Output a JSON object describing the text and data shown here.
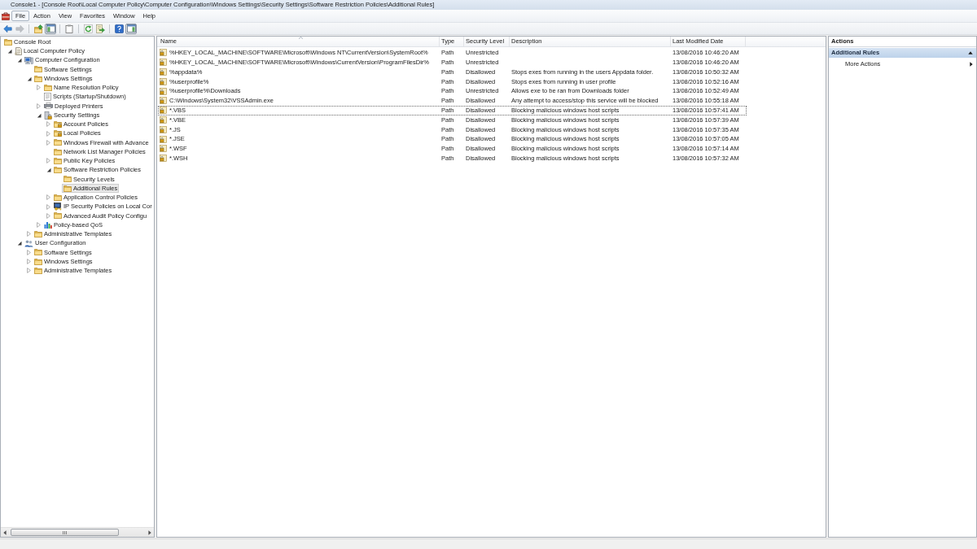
{
  "window": {
    "title": "Console1 - [Console Root\\Local Computer Policy\\Computer Configuration\\Windows Settings\\Security Settings\\Software Restriction Policies\\Additional Rules]"
  },
  "menu": [
    {
      "label": "File",
      "highlighted": true
    },
    {
      "label": "Action",
      "highlighted": false
    },
    {
      "label": "View",
      "highlighted": false
    },
    {
      "label": "Favorites",
      "highlighted": false
    },
    {
      "label": "Window",
      "highlighted": false
    },
    {
      "label": "Help",
      "highlighted": false
    }
  ],
  "toolbar": [
    {
      "kind": "back",
      "disabled": false,
      "pressed": false
    },
    {
      "kind": "forward",
      "disabled": true,
      "pressed": false
    },
    {
      "kind": "separator"
    },
    {
      "kind": "up",
      "disabled": false,
      "pressed": false
    },
    {
      "kind": "console-tree",
      "disabled": false,
      "pressed": true
    },
    {
      "kind": "separator"
    },
    {
      "kind": "properties",
      "disabled": false,
      "pressed": false
    },
    {
      "kind": "separator"
    },
    {
      "kind": "refresh",
      "disabled": false,
      "pressed": false
    },
    {
      "kind": "export",
      "disabled": false,
      "pressed": false
    },
    {
      "kind": "separator"
    },
    {
      "kind": "help",
      "disabled": false,
      "pressed": false
    },
    {
      "kind": "action-pane",
      "disabled": false,
      "pressed": true
    }
  ],
  "tree": [
    {
      "label": "Console Root",
      "kind": "folder",
      "selected": false,
      "children": [
        {
          "label": "Local Computer Policy",
          "kind": "policy",
          "selected": false,
          "expanded": true,
          "children": [
            {
              "label": "Computer Configuration",
              "kind": "computer",
              "selected": false,
              "expanded": true,
              "children": [
                {
                  "label": "Software Settings",
                  "kind": "folder",
                  "selected": false
                },
                {
                  "label": "Windows Settings",
                  "kind": "folder",
                  "selected": false,
                  "expanded": true,
                  "children": [
                    {
                      "label": "Name Resolution Policy",
                      "kind": "folder",
                      "selected": false,
                      "expanded": false
                    },
                    {
                      "label": "Scripts (Startup/Shutdown)",
                      "kind": "script",
                      "selected": false
                    },
                    {
                      "label": "Deployed Printers",
                      "kind": "printer",
                      "selected": false,
                      "expanded": false
                    },
                    {
                      "label": "Security Settings",
                      "kind": "security",
                      "selected": false,
                      "expanded": true,
                      "children": [
                        {
                          "label": "Account Policies",
                          "kind": "lock-folder",
                          "selected": false,
                          "expanded": false
                        },
                        {
                          "label": "Local Policies",
                          "kind": "lock-folder",
                          "selected": false,
                          "expanded": false
                        },
                        {
                          "label": "Windows Firewall with Advance",
                          "kind": "folder",
                          "selected": false,
                          "expanded": false
                        },
                        {
                          "label": "Network List Manager Policies",
                          "kind": "folder",
                          "selected": false
                        },
                        {
                          "label": "Public Key Policies",
                          "kind": "folder",
                          "selected": false,
                          "expanded": false
                        },
                        {
                          "label": "Software Restriction Policies",
                          "kind": "folder",
                          "selected": false,
                          "expanded": true,
                          "children": [
                            {
                              "label": "Security Levels",
                              "kind": "folder",
                              "selected": false
                            },
                            {
                              "label": "Additional Rules",
                              "kind": "folder",
                              "selected": true
                            }
                          ]
                        },
                        {
                          "label": "Application Control Policies",
                          "kind": "folder",
                          "selected": false,
                          "expanded": false
                        },
                        {
                          "label": "IP Security Policies on Local Cor",
                          "kind": "ip-security",
                          "selected": false,
                          "expanded": false
                        },
                        {
                          "label": "Advanced Audit Policy Configu",
                          "kind": "folder",
                          "selected": false,
                          "expanded": false
                        }
                      ]
                    },
                    {
                      "label": "Policy-based QoS",
                      "kind": "chart",
                      "selected": false,
                      "expanded": false
                    }
                  ]
                },
                {
                  "label": "Administrative Templates",
                  "kind": "folder",
                  "selected": false,
                  "expanded": false
                }
              ]
            },
            {
              "label": "User Configuration",
              "kind": "users",
              "selected": false,
              "expanded": true,
              "children": [
                {
                  "label": "Software Settings",
                  "kind": "folder",
                  "selected": false,
                  "expanded": false
                },
                {
                  "label": "Windows Settings",
                  "kind": "folder",
                  "selected": false,
                  "expanded": false
                },
                {
                  "label": "Administrative Templates",
                  "kind": "folder",
                  "selected": false,
                  "expanded": false
                }
              ]
            }
          ]
        }
      ]
    }
  ],
  "list": {
    "columns": [
      {
        "label": "Name",
        "sorted": true
      },
      {
        "label": "Type",
        "sorted": false
      },
      {
        "label": "Security Level",
        "sorted": false
      },
      {
        "label": "Description",
        "sorted": false
      },
      {
        "label": "Last Modified Date",
        "sorted": false
      }
    ],
    "rows": [
      {
        "name": "%HKEY_LOCAL_MACHINE\\SOFTWARE\\Microsoft\\Windows NT\\CurrentVersion\\SystemRoot%",
        "type": "Path",
        "security_level": "Unrestricted",
        "last_modified": "13/08/2016 10:46:20 AM",
        "focused": false
      },
      {
        "name": "%HKEY_LOCAL_MACHINE\\SOFTWARE\\Microsoft\\Windows\\CurrentVersion\\ProgramFilesDir%",
        "type": "Path",
        "security_level": "Unrestricted",
        "last_modified": "13/08/2016 10:46:20 AM",
        "focused": false
      },
      {
        "name": "%appdata%",
        "type": "Path",
        "security_level": "Disallowed",
        "description": "Stops exes from running in the users Appdata folder.",
        "last_modified": "13/08/2016 10:50:32 AM",
        "focused": false
      },
      {
        "name": "%userprofile%",
        "type": "Path",
        "security_level": "Disallowed",
        "description": "Stops exes from running in user profile",
        "last_modified": "13/08/2016 10:52:16 AM",
        "focused": false
      },
      {
        "name": "%userprofile%\\Downloads",
        "type": "Path",
        "security_level": "Unrestricted",
        "description": "Allows exe to be ran from Downloads folder",
        "last_modified": "13/08/2016 10:52:49 AM",
        "focused": false
      },
      {
        "name": "C:\\Windows\\System32\\VSSAdmin.exe",
        "type": "Path",
        "security_level": "Disallowed",
        "description": "Any attempt to access/stop this service will be blocked",
        "last_modified": "13/08/2016 10:55:18 AM",
        "focused": false
      },
      {
        "name": "*.VBS",
        "type": "Path",
        "security_level": "Disallowed",
        "description": "Blocking malicious windows host scripts",
        "last_modified": "13/08/2016 10:57:41 AM",
        "focused": true
      },
      {
        "name": "*.VBE",
        "type": "Path",
        "security_level": "Disallowed",
        "description": "Blocking malicious windows host scripts",
        "last_modified": "13/08/2016 10:57:39 AM",
        "focused": false
      },
      {
        "name": "*.JS",
        "type": "Path",
        "security_level": "Disallowed",
        "description": "Blocking malicious windows host scripts",
        "last_modified": "13/08/2016 10:57:35 AM",
        "focused": false
      },
      {
        "name": "*.JSE",
        "type": "Path",
        "security_level": "Disallowed",
        "description": "Blocking malicious windows host scripts",
        "last_modified": "13/08/2016 10:57:05 AM",
        "focused": false
      },
      {
        "name": "*.WSF",
        "type": "Path",
        "security_level": "Disallowed",
        "description": "Blocking malicious windows host scripts",
        "last_modified": "13/08/2016 10:57:14 AM",
        "focused": false
      },
      {
        "name": "*.WSH",
        "type": "Path",
        "security_level": "Disallowed",
        "description": "Blocking malicious windows host scripts",
        "last_modified": "13/08/2016 10:57:32 AM",
        "focused": false
      }
    ]
  },
  "actions": {
    "title": "Actions",
    "sections": [
      {
        "label": "Additional Rules",
        "expanded": true,
        "items": [
          {
            "label": "More Actions",
            "kind": "submenu"
          }
        ]
      }
    ]
  }
}
